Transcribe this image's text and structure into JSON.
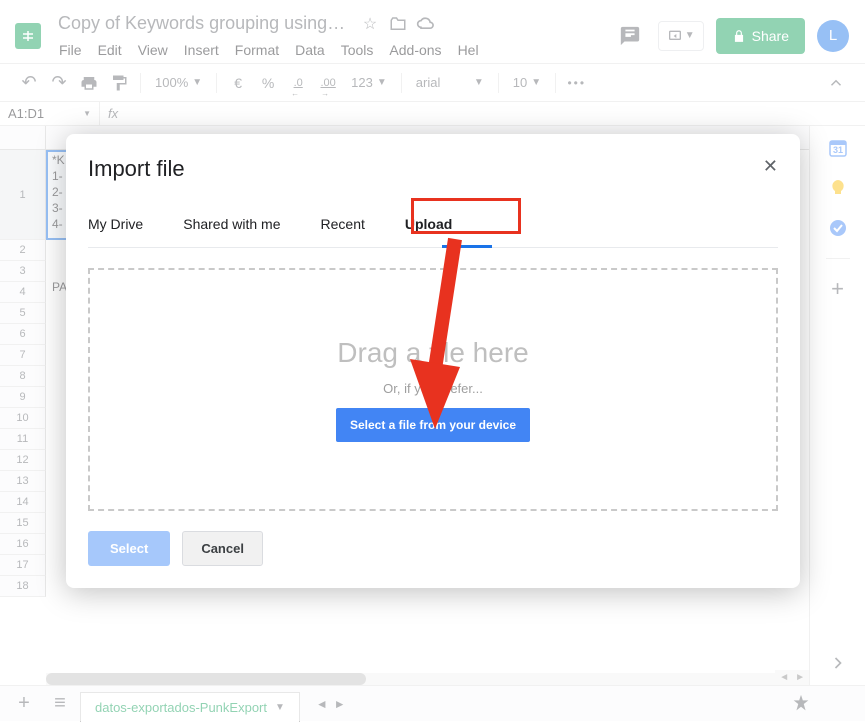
{
  "header": {
    "doc_title": "Copy of Keywords  grouping using ...",
    "share_label": "Share",
    "avatar_letter": "L"
  },
  "menus": [
    "File",
    "Edit",
    "View",
    "Insert",
    "Format",
    "Data",
    "Tools",
    "Add-ons",
    "Hel"
  ],
  "toolbar": {
    "zoom": "100%",
    "currency": "€",
    "percent": "%",
    "dec_dec": ".0",
    "inc_dec": ".00",
    "numfmt": "123",
    "font": "arial",
    "font_size": "10",
    "more": "•••"
  },
  "formula": {
    "cell_ref": "A1:D1",
    "fx": "fx"
  },
  "rows": [
    "1",
    "2",
    "3",
    "4",
    "5",
    "6",
    "7",
    "8",
    "9",
    "10",
    "11",
    "12",
    "13",
    "14",
    "15",
    "16",
    "17",
    "18"
  ],
  "sheet_tab": "datos-exportados-PunkExport",
  "modal": {
    "title": "Import file",
    "tabs": [
      "My Drive",
      "Shared with me",
      "Recent",
      "Upload"
    ],
    "active_tab_index": 3,
    "drag_text": "Drag a file here",
    "or_text": "Or, if you prefer...",
    "select_file": "Select a file from your device",
    "select_btn": "Select",
    "cancel_btn": "Cancel"
  },
  "cell_snippet": [
    "*K",
    "1-",
    "2-",
    "3-",
    "4-"
  ],
  "cell_snippet2": "PA"
}
